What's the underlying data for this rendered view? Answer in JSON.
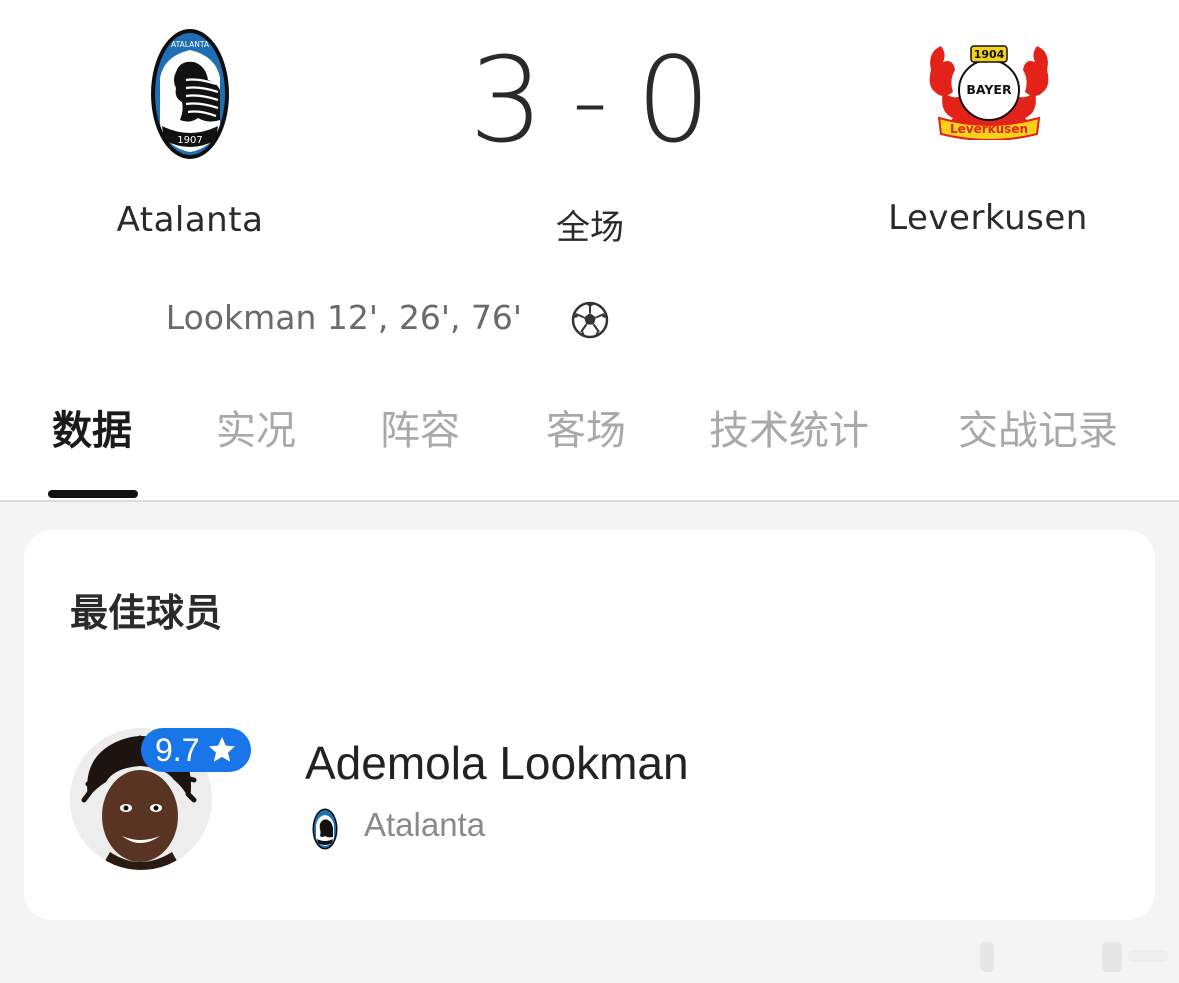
{
  "match": {
    "home_team": {
      "name": "Atalanta",
      "logo_icon": "atalanta-crest-icon",
      "crest_text": "ATALANTA",
      "crest_year": "1907"
    },
    "away_team": {
      "name": "Leverkusen",
      "logo_icon": "bayer-leverkusen-crest-icon",
      "crest_year": "1904",
      "crest_letters": "BAYER",
      "crest_banner": "Leverkusen"
    },
    "home_score": "3",
    "separator": "-",
    "away_score": "0",
    "status": "全场",
    "home_scorers": "Lookman 12', 26', 76'",
    "goal_icon": "soccer-ball-icon"
  },
  "tabs": [
    {
      "label": "数据",
      "active": true
    },
    {
      "label": "实况",
      "active": false
    },
    {
      "label": "阵容",
      "active": false
    },
    {
      "label": "客场",
      "active": false
    },
    {
      "label": "技术统计",
      "active": false
    },
    {
      "label": "交战记录",
      "active": false
    }
  ],
  "best_player": {
    "section_title": "最佳球员",
    "name": "Ademola Lookman",
    "rating": "9.7",
    "rating_icon": "star-icon",
    "team": "Atalanta",
    "team_icon": "atalanta-crest-icon"
  },
  "colors": {
    "accent_blue": "#1976e8",
    "atalanta_blue": "#1f6fb4",
    "leverkusen_red": "#e32219",
    "leverkusen_yellow": "#f5d21a"
  }
}
